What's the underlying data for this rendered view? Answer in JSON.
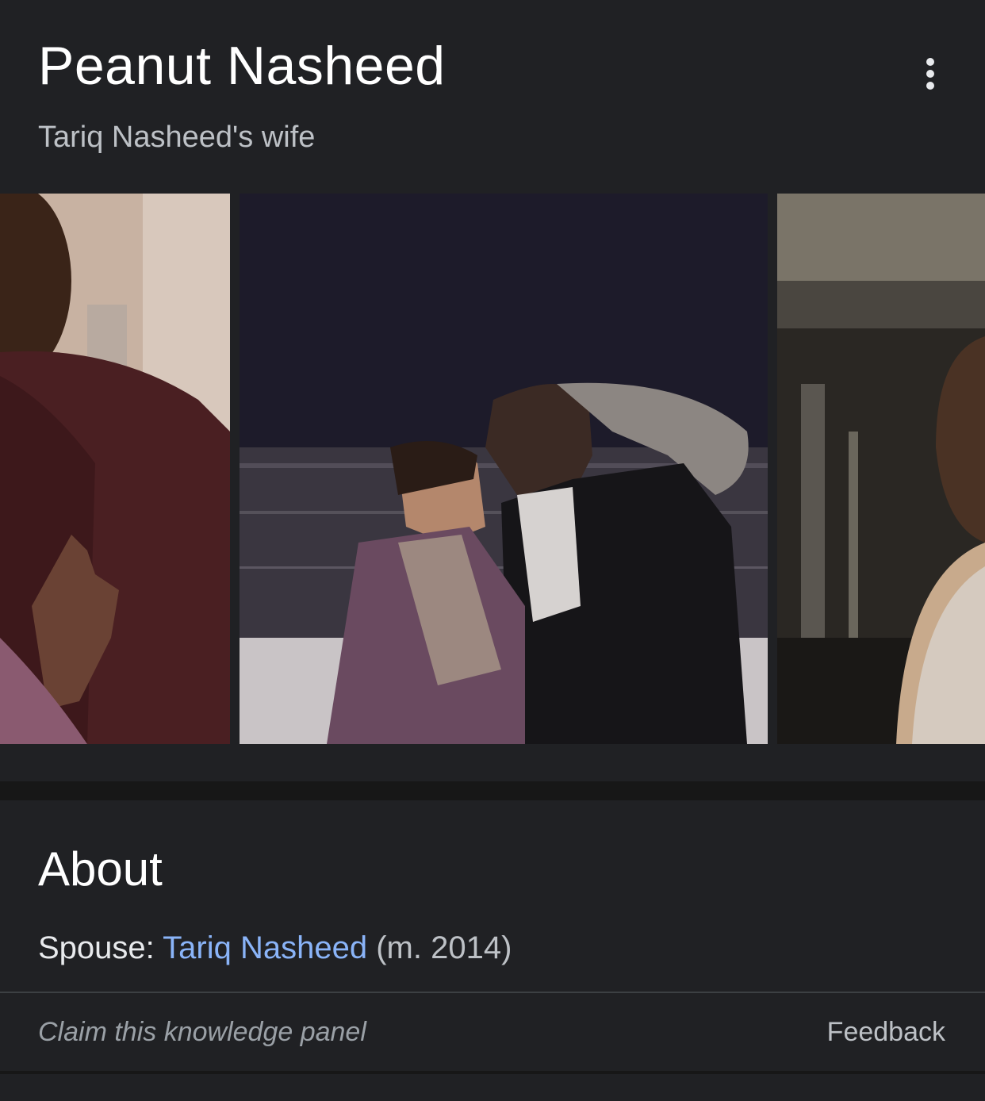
{
  "panel": {
    "title": "Peanut Nasheed",
    "subtitle": "Tariq Nasheed's wife",
    "more_icon": "more-vert-icon"
  },
  "images": [
    {
      "name": "photo-1"
    },
    {
      "name": "photo-2"
    },
    {
      "name": "photo-3"
    }
  ],
  "about": {
    "heading": "About",
    "spouse_label": "Spouse:",
    "spouse_name": "Tariq Nasheed",
    "spouse_note": "(m. 2014)"
  },
  "footer": {
    "claim": "Claim this knowledge panel",
    "feedback": "Feedback"
  },
  "colors": {
    "background": "#202124",
    "link": "#8ab4f8",
    "muted": "#9aa0a6"
  }
}
